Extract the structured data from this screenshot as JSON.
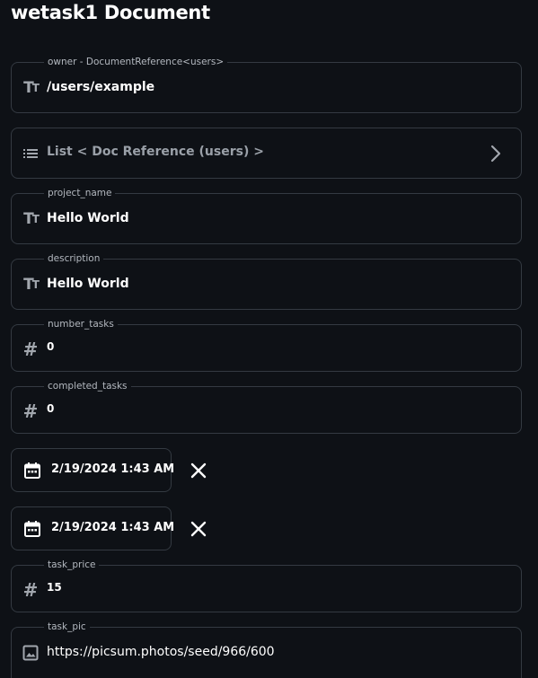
{
  "page": {
    "title": "wetask1 Document"
  },
  "fields": {
    "owner": {
      "label": "owner - DocumentReference<users>",
      "value": "/users/example",
      "icon": "text-fields-icon"
    },
    "list": {
      "label": "List < Doc Reference (users) >",
      "icon": "list-icon",
      "action_icon": "chevron-right-icon"
    },
    "project_name": {
      "label": "project_name",
      "value": "Hello World",
      "icon": "text-fields-icon"
    },
    "description": {
      "label": "description",
      "value": "Hello World",
      "icon": "text-fields-icon"
    },
    "number_tasks": {
      "label": "number_tasks",
      "value": "0",
      "icon": "hash-icon"
    },
    "completed_tasks": {
      "label": "completed_tasks",
      "value": "0",
      "icon": "hash-icon"
    },
    "task_price": {
      "label": "task_price",
      "value": "15",
      "icon": "hash-icon"
    },
    "task_pic": {
      "label": "task_pic",
      "value": "https://picsum.photos/seed/966/600",
      "icon": "image-icon"
    }
  },
  "dates": [
    {
      "value": "2/19/2024 1:43 AM",
      "icon": "calendar-icon",
      "clear_icon": "close-icon"
    },
    {
      "value": "2/19/2024 1:43 AM",
      "icon": "calendar-icon",
      "clear_icon": "close-icon"
    }
  ],
  "colors": {
    "background": "#0e1116",
    "border": "#343a42",
    "icon": "#a2a7ae",
    "label": "#b3b8bf",
    "text": "#ffffff"
  }
}
